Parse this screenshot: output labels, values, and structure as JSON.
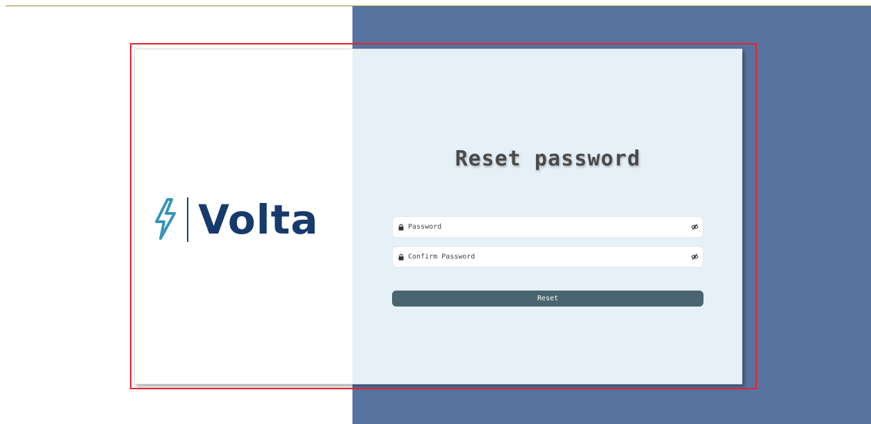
{
  "brand": {
    "name": "Volta",
    "icon": "lightning-bolt-icon",
    "text_color": "#173a6d",
    "bolt_color": "#3a94b8"
  },
  "form": {
    "title": "Reset password",
    "password_placeholder": "Password",
    "confirm_placeholder": "Confirm Password",
    "field_icon": "lock-icon",
    "toggle_icon": "eye-slash-icon",
    "submit_label": "Reset"
  },
  "colors": {
    "right_background": "#56739f",
    "card_right_panel": "#e6f0f7",
    "button": "#4a6570",
    "highlight_frame": "#e3232b"
  }
}
